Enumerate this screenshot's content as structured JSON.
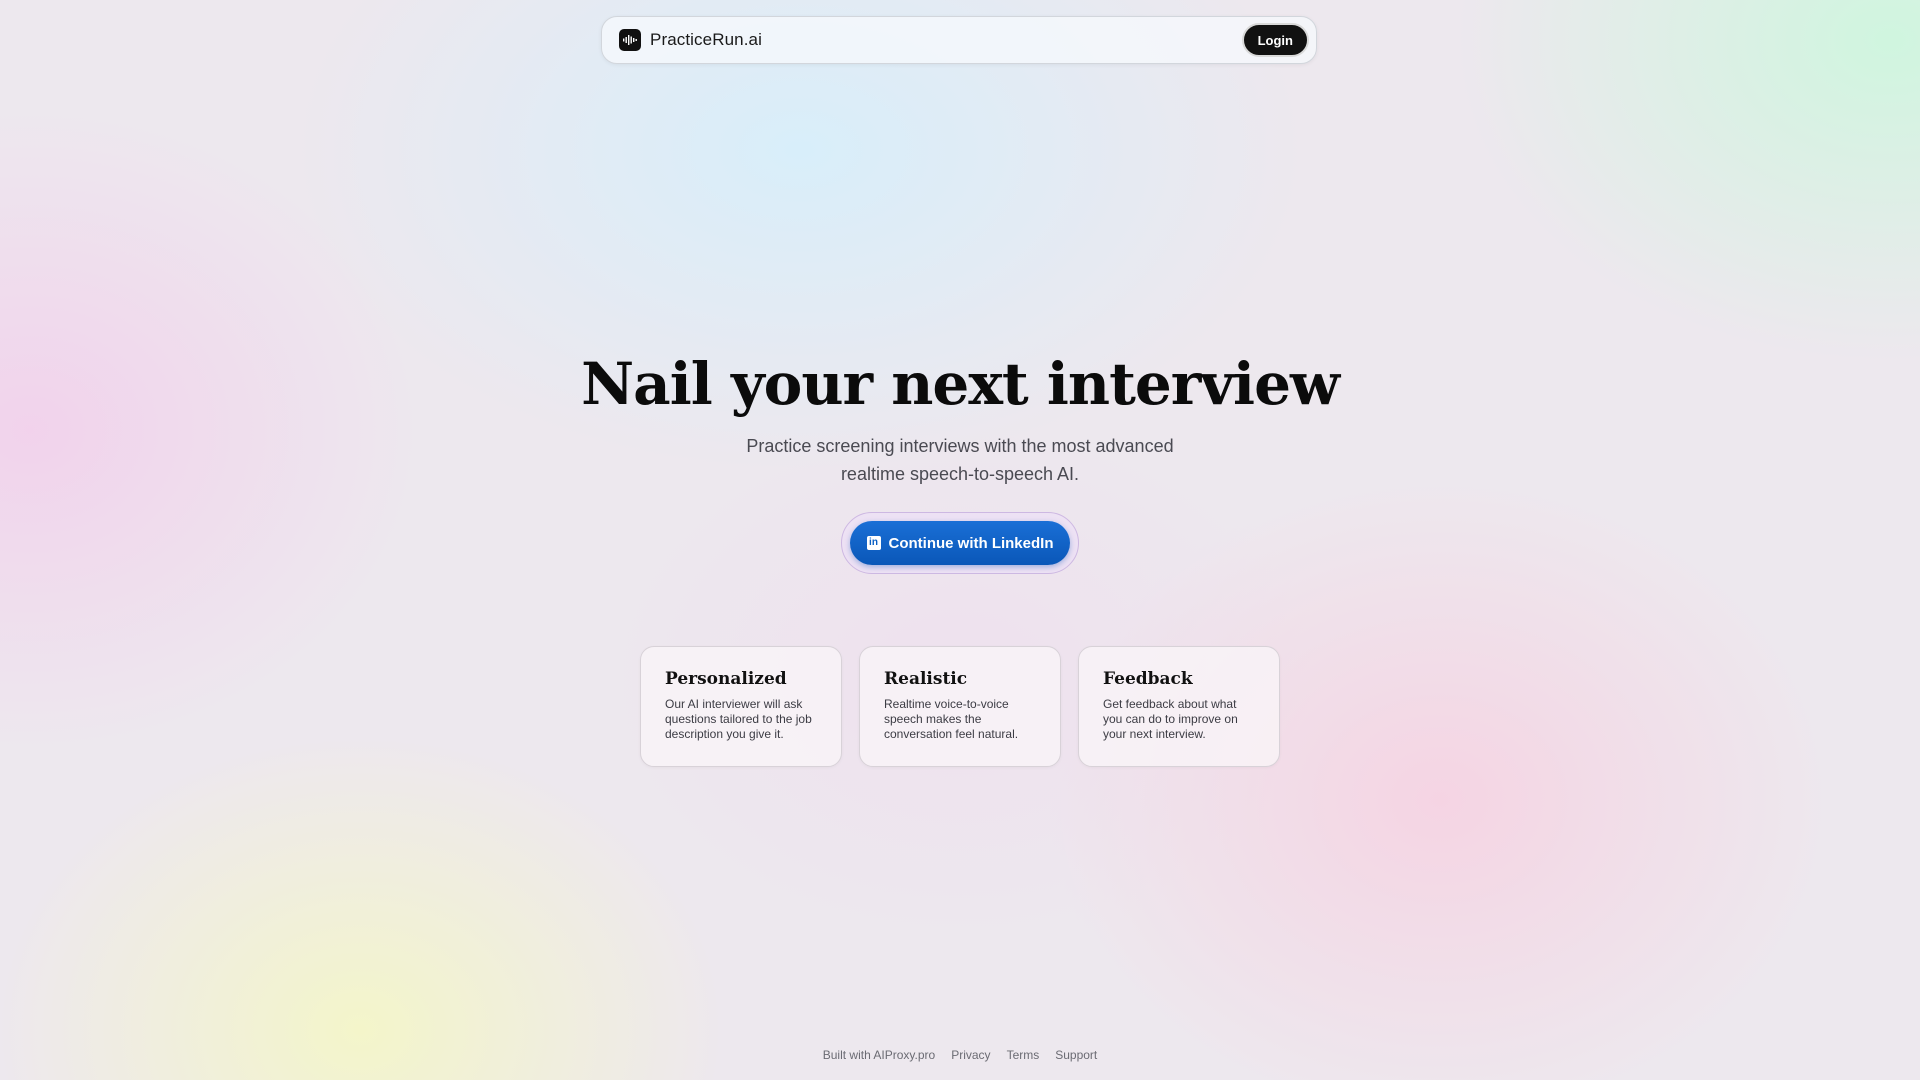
{
  "nav": {
    "brand_name": "PracticeRun.ai",
    "logo_icon": "waveform-icon",
    "login_label": "Login"
  },
  "hero": {
    "title": "Nail your next interview",
    "subtitle_line1": "Practice screening interviews with the most advanced",
    "subtitle_line2": "realtime speech-to-speech AI.",
    "cta_label": "Continue with LinkedIn",
    "cta_icon": "linkedin-icon",
    "cta_color": "#0a66c2"
  },
  "features": [
    {
      "title": "Personalized",
      "text": "Our AI interviewer will ask questions tailored to the job description you give it."
    },
    {
      "title": "Realistic",
      "text": "Realtime voice-to-voice speech makes the conversation feel natural."
    },
    {
      "title": "Feedback",
      "text": "Get feedback about what you can do to improve on your next interview."
    }
  ],
  "footer": {
    "built_with": "Built with AIProxy.pro",
    "privacy": "Privacy",
    "terms": "Terms",
    "support": "Support"
  }
}
